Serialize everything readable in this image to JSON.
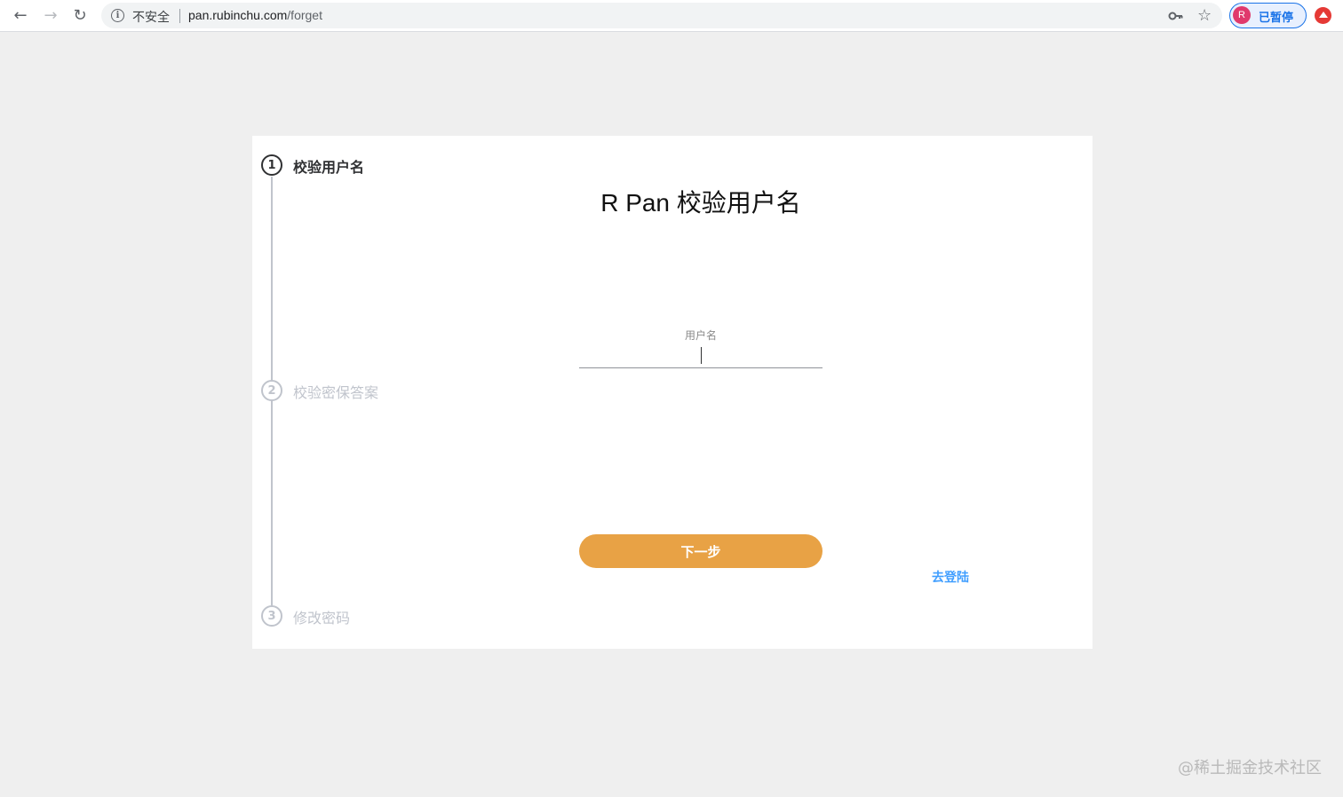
{
  "browser": {
    "security_label": "不安全",
    "url_host": "pan.rubinchu.com",
    "url_path": "/forget",
    "profile": {
      "avatar_letter": "R",
      "status_label": "已暂停"
    }
  },
  "steps": [
    {
      "number": "1",
      "label": "校验用户名",
      "active": true
    },
    {
      "number": "2",
      "label": "校验密保答案",
      "active": false
    },
    {
      "number": "3",
      "label": "修改密码",
      "active": false
    }
  ],
  "form": {
    "title": "R Pan 校验用户名",
    "username_label": "用户名",
    "username_value": "",
    "next_button": "下一步",
    "login_link": "去登陆"
  },
  "watermark": "@稀土掘金技术社区",
  "colors": {
    "button_bg": "#e8a245",
    "link": "#409eff",
    "page_bg": "#efefef"
  }
}
